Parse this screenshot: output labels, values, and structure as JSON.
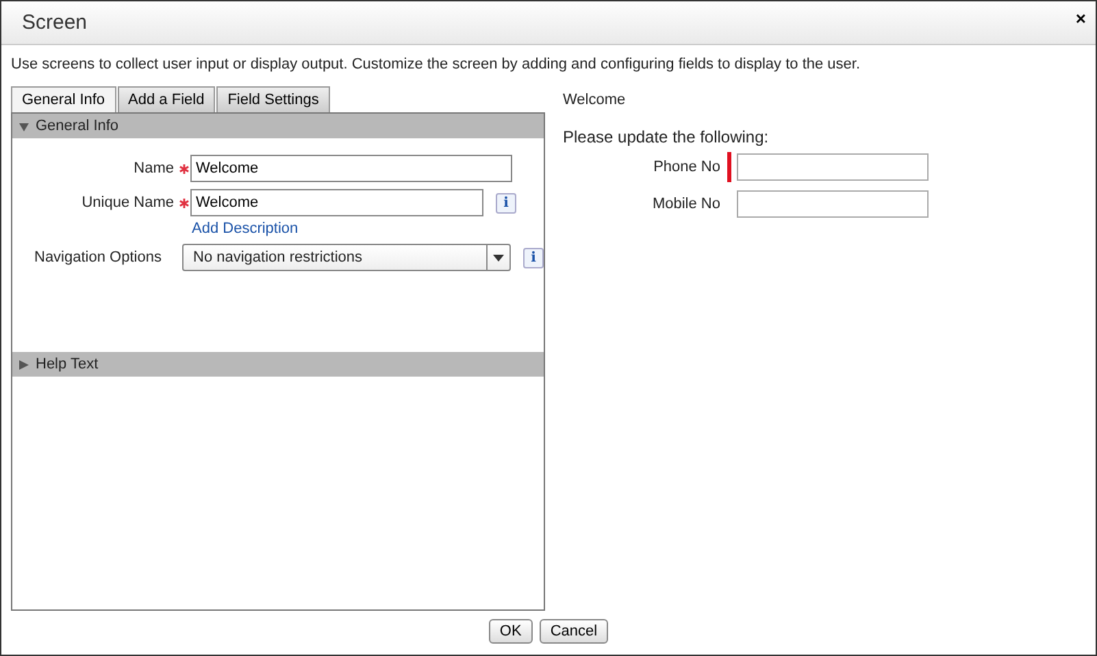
{
  "window": {
    "title": "Screen",
    "close": "×"
  },
  "description": "Use screens to collect user input or display output. Customize the screen by adding and configuring fields to display to the user.",
  "tabs": [
    {
      "label": "General Info",
      "selected": true
    },
    {
      "label": "Add a Field",
      "selected": false
    },
    {
      "label": "Field Settings",
      "selected": false
    }
  ],
  "sections": [
    {
      "title": "General Info",
      "expanded": true,
      "fields": [
        {
          "kind": "text",
          "label": "Name",
          "required": true,
          "value": "Welcome"
        },
        {
          "kind": "text",
          "label": "Unique Name",
          "required": true,
          "value": "Welcome",
          "info": "i",
          "link": "Add Description"
        },
        {
          "kind": "select",
          "label": "Navigation Options",
          "required": false,
          "value": "No navigation restrictions",
          "info": "i"
        }
      ]
    },
    {
      "title": "Help Text",
      "expanded": false
    }
  ],
  "preview": {
    "title": "Welcome",
    "intro": "Please update the following:",
    "fields": [
      {
        "label": "Phone No",
        "required": true
      },
      {
        "label": "Mobile No",
        "required": false
      }
    ]
  },
  "buttons": [
    "OK",
    "Cancel"
  ]
}
